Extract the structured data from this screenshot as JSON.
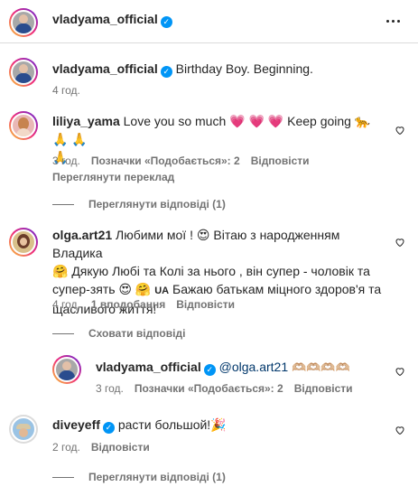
{
  "header": {
    "username": "vladyama_official",
    "verified": "✓",
    "more_icon": "more-horizontal-icon"
  },
  "caption": {
    "username": "vladyama_official",
    "verified": "✓",
    "text": "Birthday Boy. Beginning.",
    "time": "4 год."
  },
  "comments": [
    {
      "username": "liliya_yama",
      "text": "Love you so much",
      "emoji_a": "💗 💗 💗",
      "text_b": "Keep going",
      "emoji_b": "🐆 🙏 🙏",
      "emoji_c": "🙏",
      "time": "3 год.",
      "likes": "Позначки «Подобається»: 2",
      "reply": "Відповісти",
      "translate": "Переглянути переклад",
      "view_replies": "Переглянути відповіді (1)"
    },
    {
      "username": "olga.art21",
      "line1_text": "Любими мої !",
      "line1_emoji": "😍",
      "line1_text_b": "Вітаю з народженням Владика",
      "line2_emoji": "🤗",
      "line2_text": "Дякую Любі та Колі за нього , він супер - чоловік та",
      "line3_text": "супер-зять",
      "line3_emoji": "😍 🤗",
      "line3_flag": "UA",
      "line3_text_b": "Бажаю батькам міцного здоров'я та",
      "line4_text": "щасливого життя!",
      "time": "4 год.",
      "likes": "1 вподобання",
      "reply": "Відповісти",
      "hide_replies": "Сховати відповіді"
    },
    {
      "username": "vladyama_official",
      "verified": "✓",
      "mention": "@olga.art21",
      "emoji": "🫶🏼🫶🏼🫶🏼🫶🏼",
      "time": "3 год.",
      "likes": "Позначки «Подобається»: 2",
      "reply": "Відповісти"
    },
    {
      "username": "diveyeff",
      "verified": "✓",
      "text": "расти большой!",
      "emoji": "🎉",
      "time": "2 год.",
      "reply": "Відповісти",
      "view_replies": "Переглянути відповіді (1)"
    }
  ],
  "colors": {
    "verified": "#0095f6",
    "muted": "#737373",
    "heart": "#e0245e"
  }
}
